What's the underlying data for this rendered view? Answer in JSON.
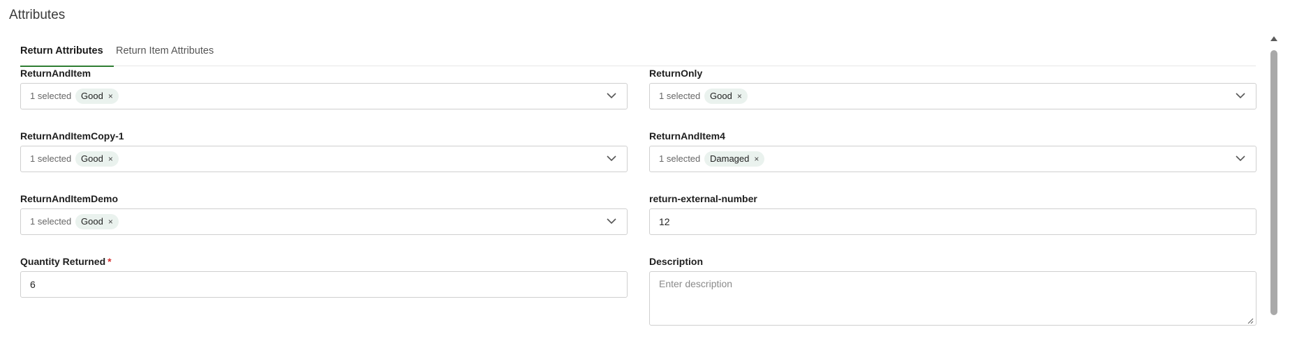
{
  "page": {
    "title": "Attributes"
  },
  "tabs": [
    {
      "label": "Return Attributes",
      "active": true
    },
    {
      "label": "Return Item Attributes",
      "active": false
    }
  ],
  "fields": {
    "return_and_item": {
      "label": "ReturnAndItem",
      "count_text": "1 selected",
      "chip": "Good",
      "chip_remove": "×"
    },
    "return_only": {
      "label": "ReturnOnly",
      "count_text": "1 selected",
      "chip": "Good",
      "chip_remove": "×"
    },
    "return_and_item_copy1": {
      "label": "ReturnAndItemCopy-1",
      "count_text": "1 selected",
      "chip": "Good",
      "chip_remove": "×"
    },
    "return_and_item4": {
      "label": "ReturnAndItem4",
      "count_text": "1 selected",
      "chip": "Damaged",
      "chip_remove": "×"
    },
    "return_and_item_demo": {
      "label": "ReturnAndItemDemo",
      "count_text": "1 selected",
      "chip": "Good",
      "chip_remove": "×"
    },
    "return_external_number": {
      "label": "return-external-number",
      "value": "12"
    },
    "quantity_returned": {
      "label": "Quantity Returned",
      "required_mark": "*",
      "value": "6"
    },
    "description": {
      "label": "Description",
      "value": "",
      "placeholder": "Enter description"
    }
  },
  "icons": {
    "dropdown": "chevron-down-icon",
    "chip_remove": "close-icon",
    "textarea_resize": "resize-handle-icon",
    "scroll_up": "scroll-up-arrow-icon"
  },
  "colors": {
    "accent": "#2e7d32",
    "chip_bg": "#eaf2ee",
    "required": "#d32f2f",
    "border": "#cfcfcf"
  }
}
